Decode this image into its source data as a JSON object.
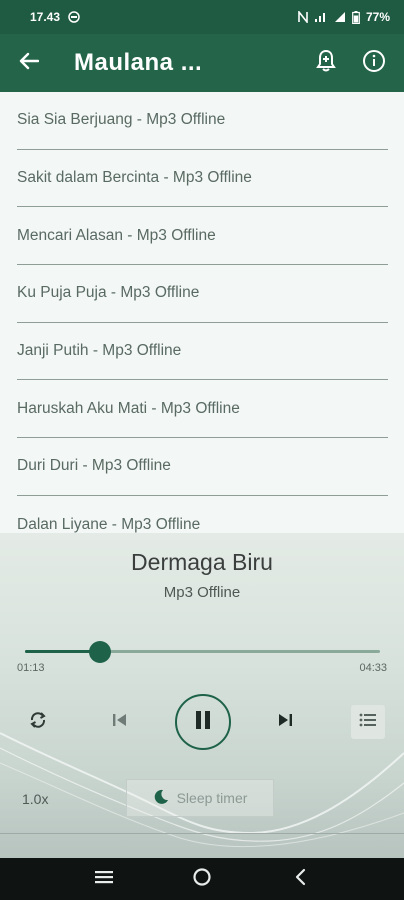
{
  "status_bar": {
    "time": "17.43",
    "battery_percent": "77%",
    "icons": [
      "vpn-icon",
      "nfc-icon",
      "wifi-signal-icon",
      "cell-signal-icon",
      "battery-icon"
    ]
  },
  "app_bar": {
    "title": "Maulana ...",
    "back_icon": "arrow-left-icon",
    "actions": [
      "notification-bell-icon",
      "info-icon"
    ]
  },
  "songs": [
    {
      "label": "Sia Sia Berjuang - Mp3 Offline"
    },
    {
      "label": "Sakit dalam Bercinta - Mp3 Offline"
    },
    {
      "label": "Mencari Alasan - Mp3 Offline"
    },
    {
      "label": "Ku Puja Puja - Mp3 Offline"
    },
    {
      "label": "Janji Putih - Mp3 Offline"
    },
    {
      "label": "Haruskah Aku Mati - Mp3 Offline"
    },
    {
      "label": "Duri Duri - Mp3 Offline"
    },
    {
      "label": "Dalan Liyane - Mp3 Offline"
    }
  ],
  "player": {
    "title": "Dermaga Biru",
    "subtitle": "Mp3 Offline",
    "current_time": "01:13",
    "total_time": "04:33",
    "progress": 0.21,
    "speed": "1.0x",
    "sleep_timer_label": "Sleep timer",
    "accent_color": "#1e6249"
  },
  "nav_bar": {
    "icons": [
      "recent-apps-icon",
      "home-icon",
      "back-icon"
    ]
  }
}
